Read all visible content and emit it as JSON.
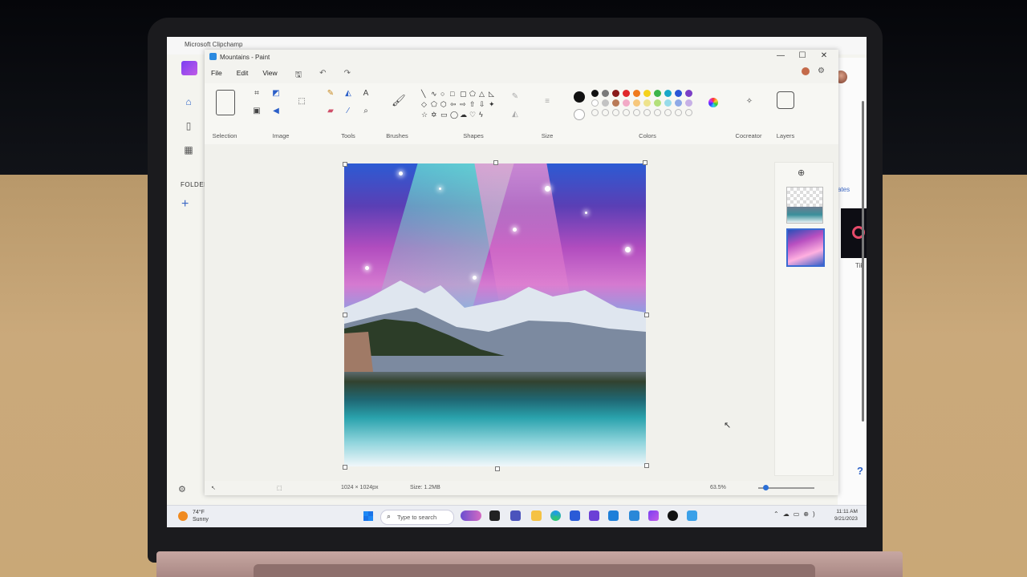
{
  "clipchamp": {
    "window_title": "Microsoft Clipchamp",
    "folders_label": "FOLDER",
    "partial_link": "ates",
    "partial_card": "Tik",
    "help_glyph": "?"
  },
  "paint": {
    "window_title": "Mountains - Paint",
    "menu": [
      "File",
      "Edit",
      "View"
    ],
    "window_controls": [
      "—",
      "☐",
      "✕"
    ],
    "groups": {
      "selection": "Selection",
      "image": "Image",
      "tools": "Tools",
      "brushes": "Brushes",
      "shapes": "Shapes",
      "size": "Size",
      "colors": "Colors",
      "cocreator": "Cocreator",
      "layers": "Layers"
    },
    "palette_row1": [
      "#111111",
      "#7a7a7a",
      "#8a1a1a",
      "#e0282b",
      "#f07a1c",
      "#f5d21c",
      "#3cb54a",
      "#19a8c9",
      "#2a55d6",
      "#7b3fc6"
    ],
    "palette_row2": [
      "#ffffff",
      "#c3c3c3",
      "#b97a57",
      "#f2a9c6",
      "#f7c77a",
      "#eee38c",
      "#b3e07a",
      "#97dbe9",
      "#8ea9e6",
      "#c7b1e6"
    ],
    "primary_color": "#111111",
    "secondary_color": "#ffffff",
    "status": {
      "dimensions": "1024 × 1024px",
      "size": "Size: 1.2MB",
      "zoom": "63.5%"
    }
  },
  "taskbar": {
    "temperature": "74°F",
    "condition": "Sunny",
    "search_placeholder": "Type to search",
    "time": "11:11 AM",
    "date": "9/21/2023"
  }
}
